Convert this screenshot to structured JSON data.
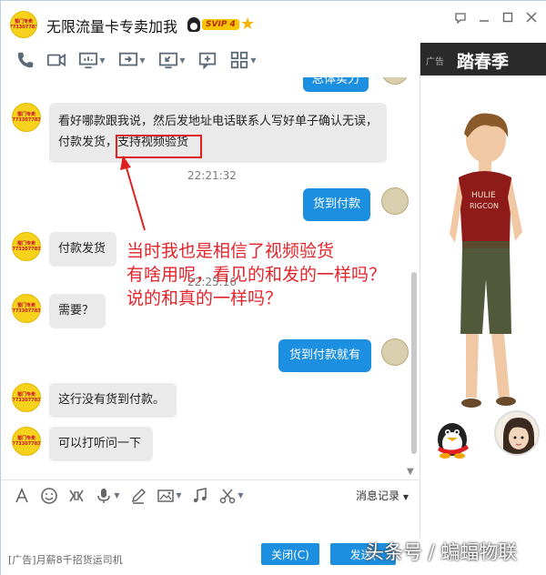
{
  "window": {
    "title": "无限流量卡专卖加我",
    "badge": "SVIP 4",
    "avatar_text": "蜀门专卖 773307783"
  },
  "toolbar": {
    "icons": [
      "phone-icon",
      "video-camera-icon",
      "screen-share-icon",
      "remote-desktop-icon",
      "screenshot-icon",
      "message-square-icon",
      "apps-grid-icon"
    ]
  },
  "chat": {
    "top_partial_message": "总体实力",
    "messages": [
      {
        "side": "left",
        "text": "看好哪款跟我说，然后发地址电话联系人写好单子确认无误，付款发货，支持视频验货"
      },
      {
        "side": "time",
        "text": "22:21:32"
      },
      {
        "side": "right",
        "text": "货到付款"
      },
      {
        "side": "left",
        "text": "付款发货"
      },
      {
        "side": "time",
        "text": "22:25:16"
      },
      {
        "side": "left",
        "text": "需要？"
      },
      {
        "side": "right",
        "text": "货到付款就有"
      },
      {
        "side": "left",
        "text": "这行没有货到付款。"
      },
      {
        "side": "left",
        "text": "可以打听问一下"
      }
    ],
    "msg0_line1": "看好哪款跟我说，然后发地址电话联系人写好单子确认无误，",
    "msg0_line2a": "付款发货，",
    "msg0_line2b": "支持视频验货",
    "time1": "22:21:32",
    "time2": "22:25:16"
  },
  "annotation": {
    "line1": "当时我也是相信了视频验货",
    "line2": "有啥用呢，看见的和发的一样吗？",
    "line3": "说的和真的一样吗？",
    "color": "#e3242b"
  },
  "input_toolbar": {
    "history_label": "消息记录"
  },
  "bottom": {
    "ad_text": "[广告]月薪8千招货运司机",
    "close_label": "关闭(C)",
    "send_label": "发送(",
    "watermark": "头条号 / 蝙蝠物联"
  },
  "ad_panel": {
    "tag": "广告",
    "title": "踏春季"
  },
  "colors": {
    "accent": "#1d8fe0",
    "bubble_left": "#eaeaea",
    "highlight": "#e02020"
  }
}
